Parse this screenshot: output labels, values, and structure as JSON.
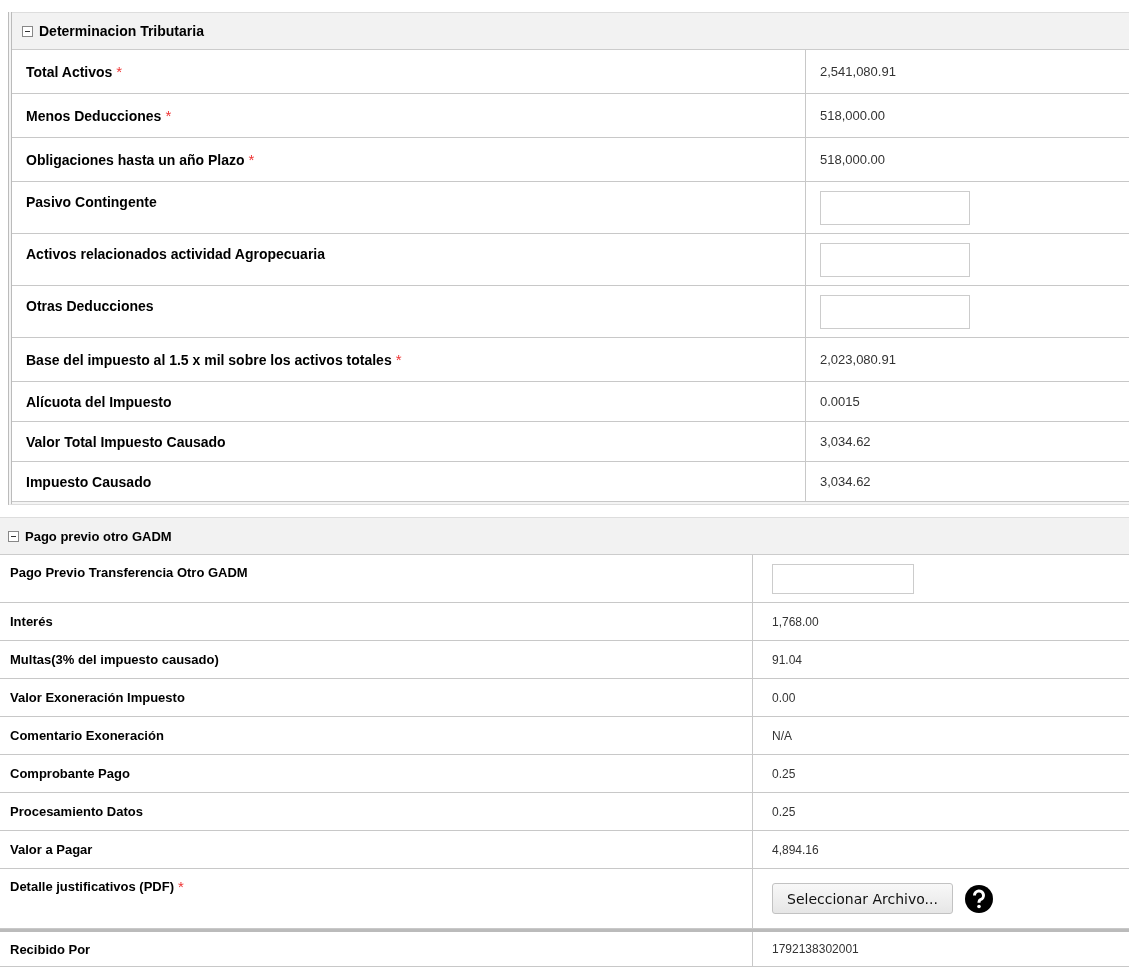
{
  "sections": [
    {
      "title": "Determinacion Tributaria",
      "kind": "framed",
      "expanded": true,
      "rows": [
        {
          "label": "Total Activos",
          "required_mark": "*",
          "kind": "text",
          "value": "2,541,080.91"
        },
        {
          "label": "Menos Deducciones",
          "required_mark": "*",
          "kind": "text",
          "value": "518,000.00"
        },
        {
          "label": "Obligaciones hasta un año Plazo",
          "required_mark": "*",
          "kind": "text",
          "value": "518,000.00"
        },
        {
          "label": "Pasivo Contingente",
          "kind": "input"
        },
        {
          "label": "Activos relacionados actividad Agropecuaria",
          "kind": "input"
        },
        {
          "label": "Otras Deducciones",
          "kind": "input"
        },
        {
          "label": "Base del impuesto al 1.5 x mil sobre los activos totales",
          "required_mark": "*",
          "kind": "text",
          "value": "2,023,080.91"
        },
        {
          "label": "Alícuota del Impuesto",
          "kind": "text",
          "value": "0.0015"
        },
        {
          "label": "Valor Total Impuesto Causado",
          "kind": "text",
          "value": "3,034.62"
        },
        {
          "label": "Impuesto Causado",
          "kind": "text",
          "value": "3,034.62"
        }
      ]
    },
    {
      "title": "Pago previo otro GADM",
      "kind": "flat",
      "expanded": true,
      "rows": [
        {
          "label": "Pago Previo Transferencia Otro GADM",
          "kind": "input"
        },
        {
          "label": "Interés",
          "kind": "text",
          "value": "1,768.00"
        },
        {
          "label": "Multas(3% del impuesto causado)",
          "kind": "text",
          "value": "91.04"
        },
        {
          "label": "Valor Exoneración Impuesto",
          "kind": "text",
          "value": "0.00"
        },
        {
          "label": "Comentario Exoneración",
          "kind": "text",
          "value": "N/A"
        },
        {
          "label": "Comprobante Pago",
          "kind": "text",
          "value": "0.25"
        },
        {
          "label": "Procesamiento Datos",
          "kind": "text",
          "value": "0.25"
        },
        {
          "label": "Valor a Pagar",
          "kind": "text",
          "value": "4,894.16"
        },
        {
          "label": "Detalle justificativos (PDF)",
          "required_mark": "*",
          "kind": "file",
          "button": "Seleccionar Archivo..."
        },
        {
          "label": "Recibido Por",
          "kind": "text",
          "value": "1792138302001",
          "divider_above": true
        }
      ]
    }
  ]
}
